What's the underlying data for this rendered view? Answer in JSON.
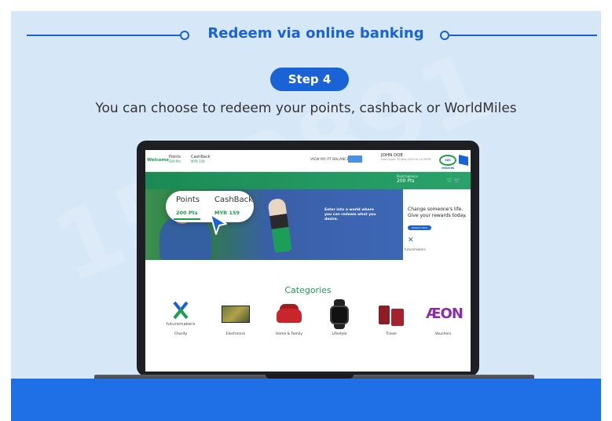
{
  "header": {
    "title": "Redeem via online banking",
    "step": "Step 4",
    "subtitle": "You can choose to redeem your points, cashback or WorldMiles"
  },
  "portal": {
    "welcome": "Welcome",
    "tabs": [
      {
        "label": "Points",
        "value": "200 Pts"
      },
      {
        "label": "CashBack",
        "value": "MYR 159"
      }
    ],
    "balance_label": "VIEW MY PT BALANCE",
    "user_name": "JOHN DOE",
    "user_sub": "Last Login: 10 Nov 2020 at 10:35PM",
    "logo_text": "360 rewards",
    "points_balance_label": "Point balance",
    "points_balance_value": "200 Pts",
    "hero_tagline": "Enter into a world where you can redeem what you desire.",
    "promo_text": "Change someone's life. Give your rewards today.",
    "promo_button": "Redeem Now",
    "promo_logo_text": "futuremakers"
  },
  "bubble": {
    "points_label": "Points",
    "points_value": "200 Pts",
    "cashback_label": "CashBack",
    "cashback_value": "MYR 159"
  },
  "categories": {
    "title": "Categories",
    "items": [
      {
        "label": "Charity"
      },
      {
        "label": "Electronics"
      },
      {
        "label": "Home & Family"
      },
      {
        "label": "Lifestyle"
      },
      {
        "label": "Travel"
      },
      {
        "label": "Vouchers"
      }
    ],
    "charity_logo_text": "futuremakers",
    "vouchers_logo_text": "ÆON"
  },
  "colors": {
    "brand_blue": "#1a63d6",
    "brand_green": "#1a9e50",
    "background": "#d6e7f7"
  }
}
